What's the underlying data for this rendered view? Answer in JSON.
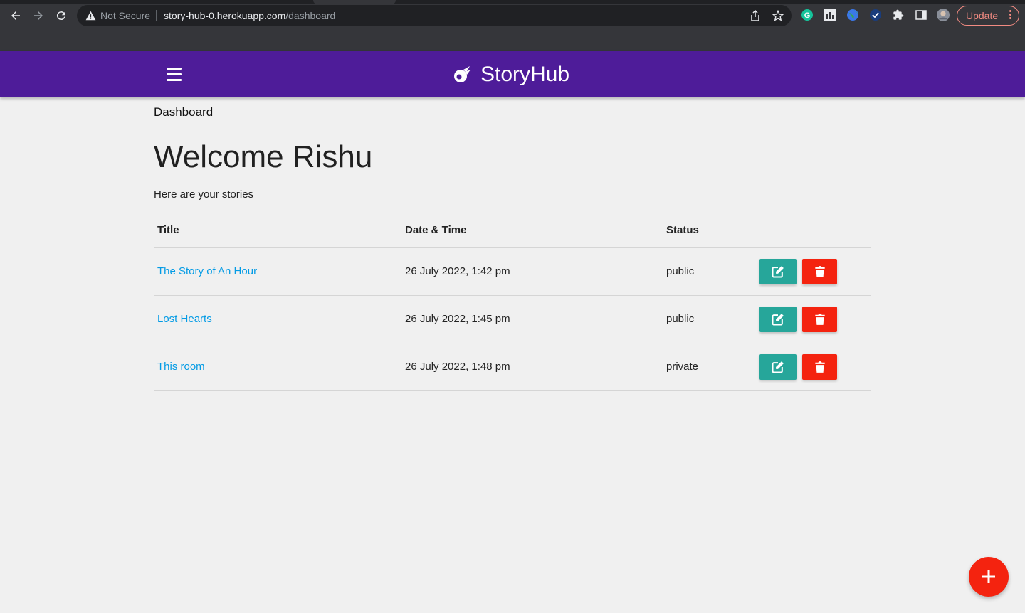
{
  "browser": {
    "security_label": "Not Secure",
    "url_host": "story-hub-0.herokuapp.com",
    "url_path": "/dashboard",
    "update_label": "Update"
  },
  "navbar": {
    "brand": "StoryHub",
    "color": "#4e1c99"
  },
  "page": {
    "breadcrumb": "Dashboard",
    "welcome": "Welcome Rishu",
    "subtitle": "Here are your stories"
  },
  "table": {
    "headers": [
      "Title",
      "Date & Time",
      "Status"
    ],
    "rows": [
      {
        "title": "The Story of An Hour",
        "datetime": "26 July 2022, 1:42 pm",
        "status": "public"
      },
      {
        "title": "Lost Hearts",
        "datetime": "26 July 2022, 1:45 pm",
        "status": "public"
      },
      {
        "title": "This room",
        "datetime": "26 July 2022, 1:48 pm",
        "status": "private"
      }
    ]
  },
  "colors": {
    "edit_button": "#26a69a",
    "delete_button": "#f4230f",
    "link": "#039be5",
    "fab": "#f4230f"
  },
  "icons": {
    "row_actions": [
      "edit-icon",
      "trash-icon"
    ],
    "fab": "plus-icon",
    "menu": "hamburger-menu-icon",
    "brand": "comet-logo-icon"
  }
}
